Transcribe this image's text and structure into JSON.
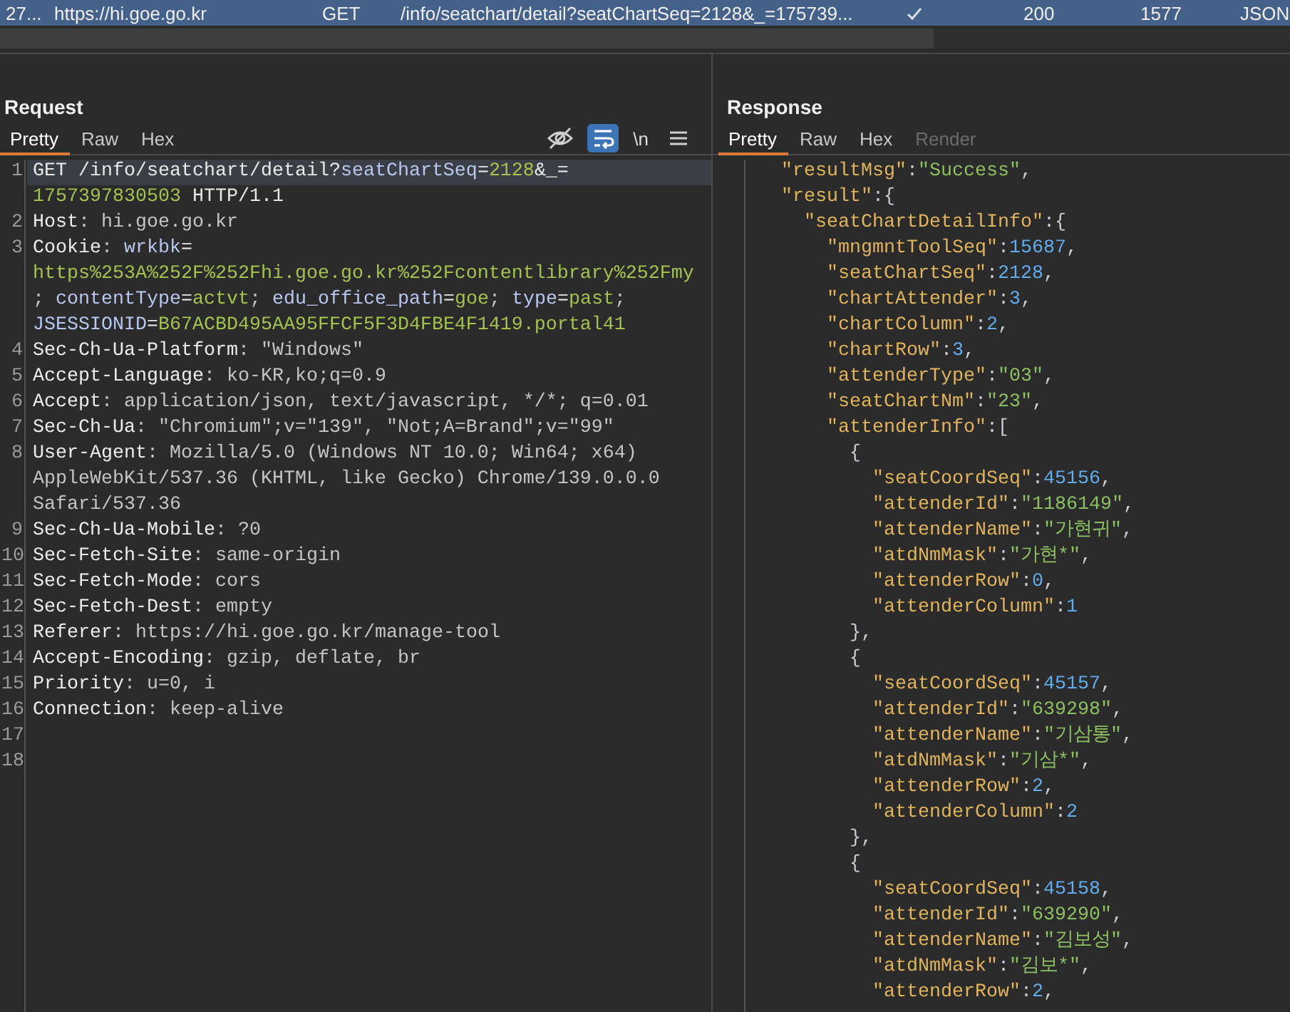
{
  "request_list_row": {
    "selected": true,
    "cells": [
      "27...",
      "https://hi.goe.go.kr",
      "GET",
      "/info/seatchart/detail?seatChartSeq=2128&_=175739...",
      "200",
      "1577",
      "JSON"
    ],
    "edited": true
  },
  "request": {
    "title": "Request",
    "tabs": [
      {
        "label": "Pretty",
        "selected": true,
        "disabled": false
      },
      {
        "label": "Raw",
        "selected": false,
        "disabled": false
      },
      {
        "label": "Hex",
        "selected": false,
        "disabled": false
      }
    ],
    "toolbar": [
      {
        "kind": "eye-off",
        "on": false
      },
      {
        "kind": "wrap",
        "on": true
      },
      {
        "kind": "text",
        "text": "\\n"
      },
      {
        "kind": "menu",
        "on": false
      }
    ],
    "lines": [
      {
        "number": "1",
        "current": true,
        "rows": [
          {
            "segments": [
              {
                "kind": "plain",
                "text": "GET /info/seatchart/detail?"
              },
              {
                "kind": "param",
                "text": "seatChartSeq"
              },
              {
                "kind": "plain",
                "text": "="
              },
              {
                "kind": "pvalue",
                "text": "2128"
              },
              {
                "kind": "plain",
                "text": "&_="
              }
            ]
          },
          {
            "segments": [
              {
                "kind": "pvalue",
                "text": "1757397830503"
              },
              {
                "kind": "plain",
                "text": " HTTP/1.1"
              }
            ]
          }
        ]
      },
      {
        "number": "2",
        "current": false,
        "rows": [
          {
            "segments": [
              {
                "kind": "name",
                "text": "Host"
              },
              {
                "kind": "value",
                "text": ": hi.goe.go.kr"
              }
            ]
          }
        ]
      },
      {
        "number": "3",
        "current": false,
        "rows": [
          {
            "segments": [
              {
                "kind": "name",
                "text": "Cookie"
              },
              {
                "kind": "value",
                "text": ": "
              },
              {
                "kind": "param",
                "text": "wrkbk"
              },
              {
                "kind": "plain",
                "text": "="
              }
            ]
          },
          {
            "segments": [
              {
                "kind": "pvalue",
                "text": "https%253A%252F%252Fhi.goe.go.kr%252Fcontentlibrary%252Fmy"
              }
            ]
          },
          {
            "segments": [
              {
                "kind": "value",
                "text": "; "
              },
              {
                "kind": "param",
                "text": "contentType"
              },
              {
                "kind": "plain",
                "text": "="
              },
              {
                "kind": "pvalue",
                "text": "actvt"
              },
              {
                "kind": "value",
                "text": "; "
              },
              {
                "kind": "param",
                "text": "edu_office_path"
              },
              {
                "kind": "plain",
                "text": "="
              },
              {
                "kind": "pvalue",
                "text": "goe"
              },
              {
                "kind": "value",
                "text": "; "
              },
              {
                "kind": "param",
                "text": "type"
              },
              {
                "kind": "plain",
                "text": "="
              },
              {
                "kind": "pvalue",
                "text": "past"
              },
              {
                "kind": "value",
                "text": ";"
              }
            ]
          },
          {
            "segments": [
              {
                "kind": "param",
                "text": "JSESSIONID"
              },
              {
                "kind": "plain",
                "text": "="
              },
              {
                "kind": "pvalue",
                "text": "B67ACBD495AA95FFCF5F3D4FBE4F1419.portal41"
              }
            ]
          }
        ]
      },
      {
        "number": "4",
        "current": false,
        "rows": [
          {
            "segments": [
              {
                "kind": "name",
                "text": "Sec-Ch-Ua-Platform"
              },
              {
                "kind": "value",
                "text": ": \"Windows\""
              }
            ]
          }
        ]
      },
      {
        "number": "5",
        "current": false,
        "rows": [
          {
            "segments": [
              {
                "kind": "name",
                "text": "Accept-Language"
              },
              {
                "kind": "value",
                "text": ": ko-KR,ko;q=0.9"
              }
            ]
          }
        ]
      },
      {
        "number": "6",
        "current": false,
        "rows": [
          {
            "segments": [
              {
                "kind": "name",
                "text": "Accept"
              },
              {
                "kind": "value",
                "text": ": application/json, text/javascript, */*; q=0.01"
              }
            ]
          }
        ]
      },
      {
        "number": "7",
        "current": false,
        "rows": [
          {
            "segments": [
              {
                "kind": "name",
                "text": "Sec-Ch-Ua"
              },
              {
                "kind": "value",
                "text": ": \"Chromium\";v=\"139\", \"Not;A=Brand\";v=\"99\""
              }
            ]
          }
        ]
      },
      {
        "number": "8",
        "current": false,
        "rows": [
          {
            "segments": [
              {
                "kind": "name",
                "text": "User-Agent"
              },
              {
                "kind": "value",
                "text": ": Mozilla/5.0 (Windows NT 10.0; Win64; x64)"
              }
            ]
          },
          {
            "segments": [
              {
                "kind": "value",
                "text": "AppleWebKit/537.36 (KHTML, like Gecko) Chrome/139.0.0.0"
              }
            ]
          },
          {
            "segments": [
              {
                "kind": "value",
                "text": "Safari/537.36"
              }
            ]
          }
        ]
      },
      {
        "number": "9",
        "current": false,
        "rows": [
          {
            "segments": [
              {
                "kind": "name",
                "text": "Sec-Ch-Ua-Mobile"
              },
              {
                "kind": "value",
                "text": ": ?0"
              }
            ]
          }
        ]
      },
      {
        "number": "10",
        "current": false,
        "rows": [
          {
            "segments": [
              {
                "kind": "name",
                "text": "Sec-Fetch-Site"
              },
              {
                "kind": "value",
                "text": ": same-origin"
              }
            ]
          }
        ]
      },
      {
        "number": "11",
        "current": false,
        "rows": [
          {
            "segments": [
              {
                "kind": "name",
                "text": "Sec-Fetch-Mode"
              },
              {
                "kind": "value",
                "text": ": cors"
              }
            ]
          }
        ]
      },
      {
        "number": "12",
        "current": false,
        "rows": [
          {
            "segments": [
              {
                "kind": "name",
                "text": "Sec-Fetch-Dest"
              },
              {
                "kind": "value",
                "text": ": empty"
              }
            ]
          }
        ]
      },
      {
        "number": "13",
        "current": false,
        "rows": [
          {
            "segments": [
              {
                "kind": "name",
                "text": "Referer"
              },
              {
                "kind": "value",
                "text": ": https://hi.goe.go.kr/manage-tool"
              }
            ]
          }
        ]
      },
      {
        "number": "14",
        "current": false,
        "rows": [
          {
            "segments": [
              {
                "kind": "name",
                "text": "Accept-Encoding"
              },
              {
                "kind": "value",
                "text": ": gzip, deflate, br"
              }
            ]
          }
        ]
      },
      {
        "number": "15",
        "current": false,
        "rows": [
          {
            "segments": [
              {
                "kind": "name",
                "text": "Priority"
              },
              {
                "kind": "value",
                "text": ": u=0, i"
              }
            ]
          }
        ]
      },
      {
        "number": "16",
        "current": false,
        "rows": [
          {
            "segments": [
              {
                "kind": "name",
                "text": "Connection"
              },
              {
                "kind": "value",
                "text": ": keep-alive"
              }
            ]
          }
        ]
      },
      {
        "number": "17",
        "current": false,
        "rows": [
          {}
        ]
      },
      {
        "number": "18",
        "current": false,
        "rows": [
          {}
        ]
      }
    ]
  },
  "response": {
    "title": "Response",
    "tabs": [
      {
        "label": "Pretty",
        "selected": true,
        "disabled": false
      },
      {
        "label": "Raw",
        "selected": false,
        "disabled": false
      },
      {
        "label": "Hex",
        "selected": false,
        "disabled": false
      },
      {
        "label": "Render",
        "selected": false,
        "disabled": true
      }
    ],
    "lines": [
      {
        "tokens": [
          {
            "kind": "key",
            "text": "\"resultMsg\""
          },
          {
            "kind": "punct",
            "text": ":"
          },
          {
            "kind": "string",
            "text": "\"Success\""
          },
          {
            "kind": "punct",
            "text": ","
          }
        ]
      },
      {
        "tokens": [
          {
            "kind": "key",
            "text": "\"result\""
          },
          {
            "kind": "punct",
            "text": ":{"
          }
        ],
        "children": [
          {
            "tokens": [
              {
                "kind": "key",
                "text": "\"seatChartDetailInfo\""
              },
              {
                "kind": "punct",
                "text": ":{"
              }
            ],
            "children": [
              {
                "tokens": [
                  {
                    "kind": "key",
                    "text": "\"mngmntToolSeq\""
                  },
                  {
                    "kind": "punct",
                    "text": ":"
                  },
                  {
                    "kind": "number",
                    "text": "15687"
                  },
                  {
                    "kind": "punct",
                    "text": ","
                  }
                ]
              },
              {
                "tokens": [
                  {
                    "kind": "key",
                    "text": "\"seatChartSeq\""
                  },
                  {
                    "kind": "punct",
                    "text": ":"
                  },
                  {
                    "kind": "number",
                    "text": "2128"
                  },
                  {
                    "kind": "punct",
                    "text": ","
                  }
                ]
              },
              {
                "tokens": [
                  {
                    "kind": "key",
                    "text": "\"chartAttender\""
                  },
                  {
                    "kind": "punct",
                    "text": ":"
                  },
                  {
                    "kind": "number",
                    "text": "3"
                  },
                  {
                    "kind": "punct",
                    "text": ","
                  }
                ]
              },
              {
                "tokens": [
                  {
                    "kind": "key",
                    "text": "\"chartColumn\""
                  },
                  {
                    "kind": "punct",
                    "text": ":"
                  },
                  {
                    "kind": "number",
                    "text": "2"
                  },
                  {
                    "kind": "punct",
                    "text": ","
                  }
                ]
              },
              {
                "tokens": [
                  {
                    "kind": "key",
                    "text": "\"chartRow\""
                  },
                  {
                    "kind": "punct",
                    "text": ":"
                  },
                  {
                    "kind": "number",
                    "text": "3"
                  },
                  {
                    "kind": "punct",
                    "text": ","
                  }
                ]
              },
              {
                "tokens": [
                  {
                    "kind": "key",
                    "text": "\"attenderType\""
                  },
                  {
                    "kind": "punct",
                    "text": ":"
                  },
                  {
                    "kind": "string",
                    "text": "\"03\""
                  },
                  {
                    "kind": "punct",
                    "text": ","
                  }
                ]
              },
              {
                "tokens": [
                  {
                    "kind": "key",
                    "text": "\"seatChartNm\""
                  },
                  {
                    "kind": "punct",
                    "text": ":"
                  },
                  {
                    "kind": "string",
                    "text": "\"23\""
                  },
                  {
                    "kind": "punct",
                    "text": ","
                  }
                ]
              },
              {
                "tokens": [
                  {
                    "kind": "key",
                    "text": "\"attenderInfo\""
                  },
                  {
                    "kind": "punct",
                    "text": ":["
                  }
                ],
                "children": [
                  {
                    "tokens": [
                      {
                        "kind": "punct",
                        "text": "{"
                      }
                    ],
                    "children": [
                      {
                        "tokens": [
                          {
                            "kind": "key",
                            "text": "\"seatCoordSeq\""
                          },
                          {
                            "kind": "punct",
                            "text": ":"
                          },
                          {
                            "kind": "number",
                            "text": "45156"
                          },
                          {
                            "kind": "punct",
                            "text": ","
                          }
                        ]
                      },
                      {
                        "tokens": [
                          {
                            "kind": "key",
                            "text": "\"attenderId\""
                          },
                          {
                            "kind": "punct",
                            "text": ":"
                          },
                          {
                            "kind": "string",
                            "text": "\"1186149\""
                          },
                          {
                            "kind": "punct",
                            "text": ","
                          }
                        ]
                      },
                      {
                        "tokens": [
                          {
                            "kind": "key",
                            "text": "\"attenderName\""
                          },
                          {
                            "kind": "punct",
                            "text": ":"
                          },
                          {
                            "kind": "string",
                            "text": "\"가현귀\""
                          },
                          {
                            "kind": "punct",
                            "text": ","
                          }
                        ]
                      },
                      {
                        "tokens": [
                          {
                            "kind": "key",
                            "text": "\"atdNmMask\""
                          },
                          {
                            "kind": "punct",
                            "text": ":"
                          },
                          {
                            "kind": "string",
                            "text": "\"가현*\""
                          },
                          {
                            "kind": "punct",
                            "text": ","
                          }
                        ]
                      },
                      {
                        "tokens": [
                          {
                            "kind": "key",
                            "text": "\"attenderRow\""
                          },
                          {
                            "kind": "punct",
                            "text": ":"
                          },
                          {
                            "kind": "number",
                            "text": "0"
                          },
                          {
                            "kind": "punct",
                            "text": ","
                          }
                        ]
                      },
                      {
                        "tokens": [
                          {
                            "kind": "key",
                            "text": "\"attenderColumn\""
                          },
                          {
                            "kind": "punct",
                            "text": ":"
                          },
                          {
                            "kind": "number",
                            "text": "1"
                          }
                        ]
                      }
                    ]
                  },
                  {
                    "tokens": [
                      {
                        "kind": "punct",
                        "text": "},"
                      }
                    ]
                  },
                  {
                    "tokens": [
                      {
                        "kind": "punct",
                        "text": "{"
                      }
                    ],
                    "children": [
                      {
                        "tokens": [
                          {
                            "kind": "key",
                            "text": "\"seatCoordSeq\""
                          },
                          {
                            "kind": "punct",
                            "text": ":"
                          },
                          {
                            "kind": "number",
                            "text": "45157"
                          },
                          {
                            "kind": "punct",
                            "text": ","
                          }
                        ]
                      },
                      {
                        "tokens": [
                          {
                            "kind": "key",
                            "text": "\"attenderId\""
                          },
                          {
                            "kind": "punct",
                            "text": ":"
                          },
                          {
                            "kind": "string",
                            "text": "\"639298\""
                          },
                          {
                            "kind": "punct",
                            "text": ","
                          }
                        ]
                      },
                      {
                        "tokens": [
                          {
                            "kind": "key",
                            "text": "\"attenderName\""
                          },
                          {
                            "kind": "punct",
                            "text": ":"
                          },
                          {
                            "kind": "string",
                            "text": "\"기삼통\""
                          },
                          {
                            "kind": "punct",
                            "text": ","
                          }
                        ]
                      },
                      {
                        "tokens": [
                          {
                            "kind": "key",
                            "text": "\"atdNmMask\""
                          },
                          {
                            "kind": "punct",
                            "text": ":"
                          },
                          {
                            "kind": "string",
                            "text": "\"기삼*\""
                          },
                          {
                            "kind": "punct",
                            "text": ","
                          }
                        ]
                      },
                      {
                        "tokens": [
                          {
                            "kind": "key",
                            "text": "\"attenderRow\""
                          },
                          {
                            "kind": "punct",
                            "text": ":"
                          },
                          {
                            "kind": "number",
                            "text": "2"
                          },
                          {
                            "kind": "punct",
                            "text": ","
                          }
                        ]
                      },
                      {
                        "tokens": [
                          {
                            "kind": "key",
                            "text": "\"attenderColumn\""
                          },
                          {
                            "kind": "punct",
                            "text": ":"
                          },
                          {
                            "kind": "number",
                            "text": "2"
                          }
                        ]
                      }
                    ]
                  },
                  {
                    "tokens": [
                      {
                        "kind": "punct",
                        "text": "},"
                      }
                    ]
                  },
                  {
                    "tokens": [
                      {
                        "kind": "punct",
                        "text": "{"
                      }
                    ],
                    "children": [
                      {
                        "tokens": [
                          {
                            "kind": "key",
                            "text": "\"seatCoordSeq\""
                          },
                          {
                            "kind": "punct",
                            "text": ":"
                          },
                          {
                            "kind": "number",
                            "text": "45158"
                          },
                          {
                            "kind": "punct",
                            "text": ","
                          }
                        ]
                      },
                      {
                        "tokens": [
                          {
                            "kind": "key",
                            "text": "\"attenderId\""
                          },
                          {
                            "kind": "punct",
                            "text": ":"
                          },
                          {
                            "kind": "string",
                            "text": "\"639290\""
                          },
                          {
                            "kind": "punct",
                            "text": ","
                          }
                        ]
                      },
                      {
                        "tokens": [
                          {
                            "kind": "key",
                            "text": "\"attenderName\""
                          },
                          {
                            "kind": "punct",
                            "text": ":"
                          },
                          {
                            "kind": "string",
                            "text": "\"김보성\""
                          },
                          {
                            "kind": "punct",
                            "text": ","
                          }
                        ]
                      },
                      {
                        "tokens": [
                          {
                            "kind": "key",
                            "text": "\"atdNmMask\""
                          },
                          {
                            "kind": "punct",
                            "text": ":"
                          },
                          {
                            "kind": "string",
                            "text": "\"김보*\""
                          },
                          {
                            "kind": "punct",
                            "text": ","
                          }
                        ]
                      },
                      {
                        "tokens": [
                          {
                            "kind": "key",
                            "text": "\"attenderRow\""
                          },
                          {
                            "kind": "punct",
                            "text": ":"
                          },
                          {
                            "kind": "number",
                            "text": "2"
                          },
                          {
                            "kind": "punct",
                            "text": ","
                          }
                        ]
                      }
                    ]
                  }
                ]
              }
            ]
          }
        ]
      }
    ]
  }
}
